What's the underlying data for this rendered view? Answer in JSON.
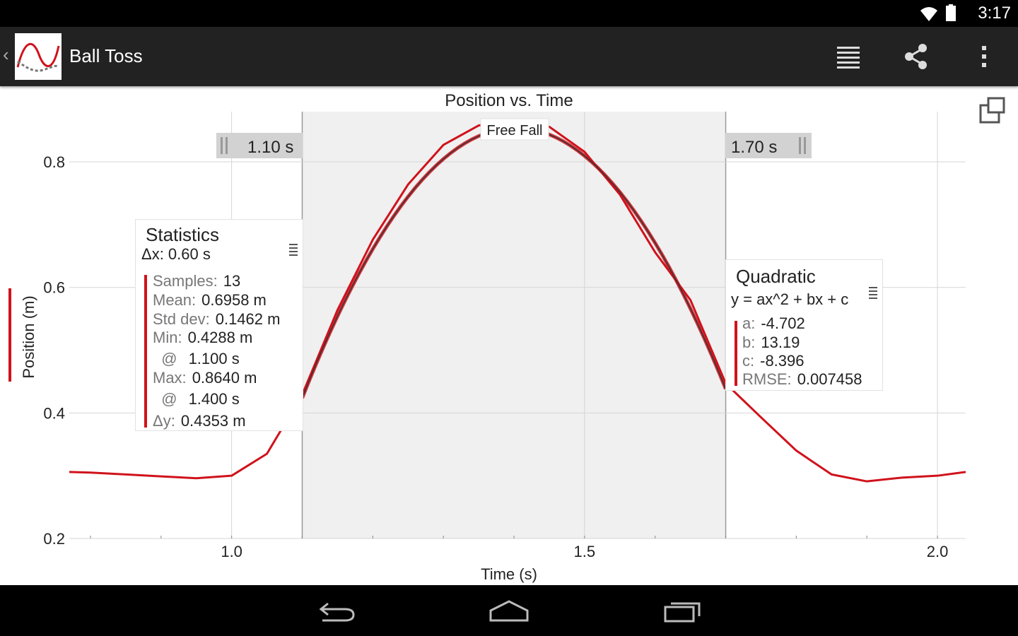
{
  "status_bar": {
    "time": "3:17"
  },
  "action_bar": {
    "title": "Ball Toss",
    "icons": [
      "app-logo",
      "list-view-icon",
      "share-icon",
      "overflow-menu-icon"
    ]
  },
  "chart": {
    "title": "Position vs. Time",
    "xlabel": "Time (s)",
    "ylabel": "Position (m)",
    "x_ticks": [
      "1.0",
      "1.5",
      "2.0"
    ],
    "y_ticks": [
      "0.2",
      "0.4",
      "0.6",
      "0.8"
    ],
    "selection_start_label": "1.10 s",
    "selection_end_label": "1.70 s",
    "region_label": "Free Fall"
  },
  "stats_box": {
    "title": "Statistics",
    "delta_x": "Δx: 0.60 s",
    "rows": [
      {
        "key": "Samples:",
        "value": "13"
      },
      {
        "key": "Mean:",
        "value": "0.6958 m"
      },
      {
        "key": "Std dev:",
        "value": "0.1462 m"
      },
      {
        "key": "Min:",
        "value": "0.4288 m"
      },
      {
        "key": "  @",
        "value": "1.100 s"
      },
      {
        "key": "Max:",
        "value": "0.8640 m"
      },
      {
        "key": "  @",
        "value": "1.400 s"
      },
      {
        "key": "Δy:",
        "value": "0.4353 m"
      }
    ]
  },
  "fit_box": {
    "title": "Quadratic",
    "equation": "y = ax^2 + bx + c",
    "rows": [
      {
        "key": "a:",
        "value": "-4.702"
      },
      {
        "key": "b:",
        "value": "13.19"
      },
      {
        "key": "c:",
        "value": "-8.396"
      },
      {
        "key": "RMSE:",
        "value": "0.007458"
      }
    ]
  },
  "chart_data": {
    "type": "line",
    "title": "Position vs. Time",
    "xlabel": "Time (s)",
    "ylabel": "Position (m)",
    "xlim": [
      0.77,
      2.04
    ],
    "ylim": [
      0.2,
      0.88
    ],
    "grid": true,
    "series": [
      {
        "name": "Position",
        "color": "#d0121b",
        "x": [
          0.77,
          0.8,
          0.85,
          0.9,
          0.95,
          1.0,
          1.05,
          1.1,
          1.15,
          1.2,
          1.25,
          1.3,
          1.35,
          1.4,
          1.45,
          1.5,
          1.55,
          1.6,
          1.65,
          1.7,
          1.75,
          1.8,
          1.85,
          1.9,
          1.95,
          2.0,
          2.04
        ],
        "y": [
          0.306,
          0.305,
          0.302,
          0.299,
          0.296,
          0.3,
          0.335,
          0.429,
          0.564,
          0.676,
          0.764,
          0.827,
          0.858,
          0.864,
          0.856,
          0.816,
          0.748,
          0.656,
          0.58,
          0.447,
          0.393,
          0.34,
          0.302,
          0.291,
          0.297,
          0.3,
          0.306
        ]
      }
    ],
    "fit": {
      "type": "quadratic",
      "x_range": [
        1.1,
        1.7
      ],
      "a": -4.702,
      "b": 13.19,
      "c": -8.396,
      "color": "#333333"
    },
    "selection": {
      "x_start": 1.1,
      "x_end": 1.7,
      "label": "Free Fall"
    }
  }
}
